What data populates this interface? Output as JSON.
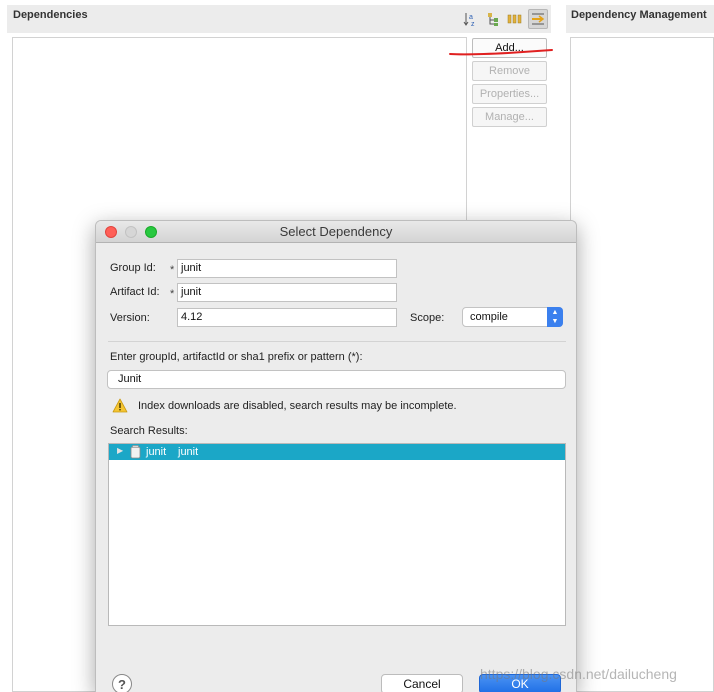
{
  "editor": {
    "dependencies_title": "Dependencies",
    "dependency_management_title": "Dependency Management",
    "buttons": {
      "add": "Add...",
      "remove": "Remove",
      "properties": "Properties...",
      "manage": "Manage..."
    }
  },
  "dialog": {
    "title": "Select Dependency",
    "group_id_label": "Group Id:",
    "group_id_value": "junit",
    "artifact_id_label": "Artifact Id:",
    "artifact_id_value": "junit",
    "version_label": "Version:",
    "version_value": "4.12",
    "scope_label": "Scope:",
    "scope_value": "compile",
    "required_marker": "*",
    "search_prompt": "Enter groupId, artifactId or sha1 prefix or pattern (*):",
    "search_value": "Junit",
    "warning": "Index downloads are disabled, search results may be incomplete.",
    "results_label": "Search Results:",
    "results": [
      {
        "group": "junit",
        "artifact": "junit",
        "selected": true
      }
    ],
    "cancel_label": "Cancel",
    "ok_label": "OK",
    "help_label": "?"
  },
  "watermark": "https://blog.csdn.net/dailucheng",
  "colors": {
    "selection": "#1ba7c7",
    "primary_button": "#1f6fe6",
    "annotation_underline": "#e02020"
  }
}
